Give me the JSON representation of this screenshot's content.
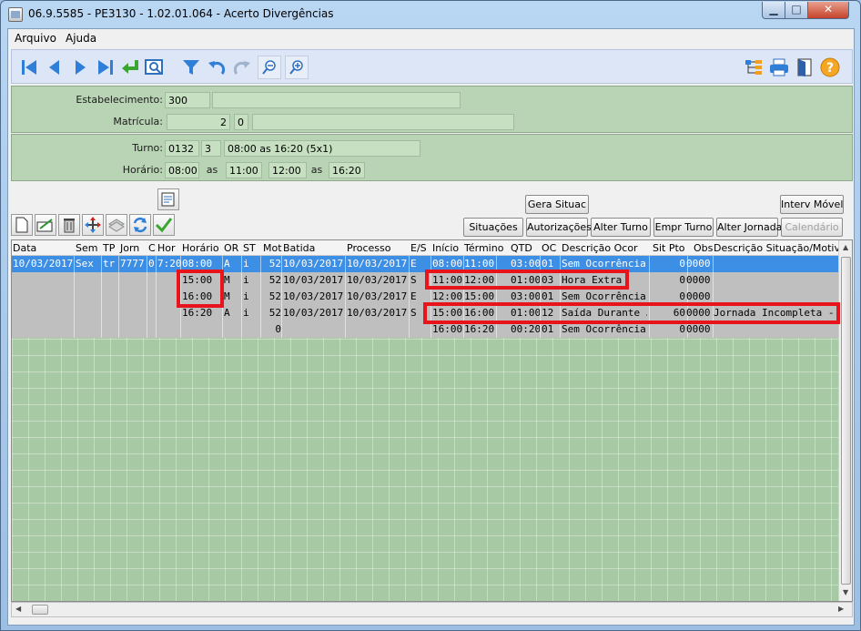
{
  "window": {
    "title": "06.9.5585 - PE3130 - 1.02.01.064 - Acerto Divergências"
  },
  "menu": {
    "arquivo": "Arquivo",
    "ajuda": "Ajuda"
  },
  "header": {
    "estabelecimento_label": "Estabelecimento:",
    "estabelecimento_value": "300",
    "estabelecimento_desc": "",
    "matricula_label": "Matrícula:",
    "matricula_value": "2",
    "matricula_digit": "0",
    "matricula_name": "",
    "turno_label": "Turno:",
    "turno_code": "0132",
    "turno_seq": "3",
    "turno_desc": "08:00 as 16:20 (5x1)",
    "horario_label": "Horário:",
    "horario_1": "08:00",
    "as_1": "as",
    "horario_2": "11:00",
    "horario_3": "12:00",
    "as_2": "as",
    "horario_4": "16:20"
  },
  "buttons": {
    "gera_situac": "Gera Situac",
    "interv_movel": "Interv Móvel",
    "situacoes": "Situações",
    "autorizacoes": "Autorizações",
    "alter_turno": "Alter Turno",
    "empr_turno": "Empr Turno",
    "alter_jornada": "Alter Jornada",
    "calendario": "Calendário"
  },
  "grid": {
    "columns": [
      "Data",
      "Sem",
      "TP",
      "Jorn",
      "C",
      "Hor",
      "Horário",
      "OR",
      "ST",
      "Mot",
      "Batida",
      "Processo",
      "E/S",
      "Início",
      "Término",
      "QTD",
      "OC",
      "Descrição Ocor",
      "Sit Pto",
      "Obs",
      "Descrição Situação/Motivo"
    ],
    "rows": [
      {
        "data": "10/03/2017",
        "sem": "Sex",
        "tp": "tr",
        "jorn": "7777",
        "c": "0",
        "hor": "7:20",
        "horario": "08:00",
        "or": "A",
        "st": "i",
        "mot": "52",
        "batida": "10/03/2017",
        "processo": "10/03/2017",
        "es": "E",
        "inicio": "08:00",
        "termino": "11:00",
        "qtd": "03:00",
        "oc": "01",
        "desc_ocor": "Sem Ocorrência",
        "sit_pto": "0",
        "obs": "0000",
        "desc_sit": ""
      },
      {
        "data": "",
        "sem": "",
        "tp": "",
        "jorn": "",
        "c": "",
        "hor": "",
        "horario": "15:00",
        "or": "M",
        "st": "i",
        "mot": "52",
        "batida": "10/03/2017",
        "processo": "10/03/2017",
        "es": "S",
        "inicio": "11:00",
        "termino": "12:00",
        "qtd": "01:00",
        "oc": "03",
        "desc_ocor": "Hora Extra",
        "sit_pto": "0",
        "obs": "0000",
        "desc_sit": ""
      },
      {
        "data": "",
        "sem": "",
        "tp": "",
        "jorn": "",
        "c": "",
        "hor": "",
        "horario": "16:00",
        "or": "M",
        "st": "i",
        "mot": "52",
        "batida": "10/03/2017",
        "processo": "10/03/2017",
        "es": "E",
        "inicio": "12:00",
        "termino": "15:00",
        "qtd": "03:00",
        "oc": "01",
        "desc_ocor": "Sem Ocorrência",
        "sit_pto": "0",
        "obs": "0000",
        "desc_sit": ""
      },
      {
        "data": "",
        "sem": "",
        "tp": "",
        "jorn": "",
        "c": "",
        "hor": "",
        "horario": "16:20",
        "or": "A",
        "st": "i",
        "mot": "52",
        "batida": "10/03/2017",
        "processo": "10/03/2017",
        "es": "S",
        "inicio": "15:00",
        "termino": "16:00",
        "qtd": "01:00",
        "oc": "12",
        "desc_ocor": "Saída Durante Jornada",
        "sit_pto": "60",
        "obs": "0000",
        "desc_sit": "Jornada Incompleta - Falta"
      },
      {
        "data": "",
        "sem": "",
        "tp": "",
        "jorn": "",
        "c": "",
        "hor": "",
        "horario": "",
        "or": "",
        "st": "",
        "mot": "0",
        "batida": "",
        "processo": "",
        "es": "",
        "inicio": "16:00",
        "termino": "16:20",
        "qtd": "00:20",
        "oc": "01",
        "desc_ocor": "Sem Ocorrência",
        "sit_pto": "0",
        "obs": "0000",
        "desc_sit": ""
      }
    ]
  },
  "colors": {
    "accent": "#3d8ee5",
    "panel": "#b9d4b4",
    "grid": "#a7c9a3",
    "highlight": "#e8141c"
  }
}
